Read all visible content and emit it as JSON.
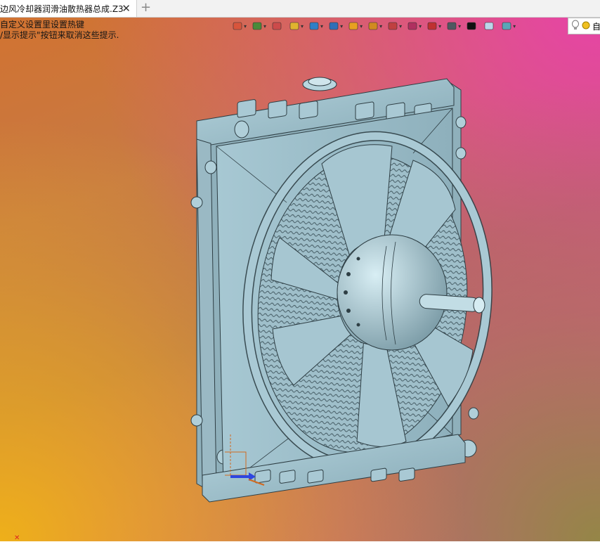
{
  "tab": {
    "title": "边风冷却器润滑油散热器总成.Z3",
    "close": "✕",
    "new": "+"
  },
  "hints": [
    "自定义设置里设置热键",
    "/显示提示\"按钮来取消这些提示."
  ],
  "toolbar": {
    "items": [
      {
        "name": "import-icon",
        "color": "#d8553c"
      },
      {
        "name": "paint-icon",
        "color": "#4a8a3a"
      },
      {
        "name": "brush-icon",
        "color": "#cc4b4b"
      },
      {
        "name": "part-icon",
        "color": "#e0b32f"
      },
      {
        "name": "solid-icon",
        "color": "#2f7fc7"
      },
      {
        "name": "assembly-icon",
        "color": "#2f6fb7"
      },
      {
        "name": "render-icon",
        "color": "#e8a020"
      },
      {
        "name": "zoom-icon",
        "color": "#d18a20"
      },
      {
        "name": "view-icon",
        "color": "#c04040"
      },
      {
        "name": "section-icon",
        "color": "#b03060"
      },
      {
        "name": "measure-icon",
        "color": "#c03030"
      },
      {
        "name": "display-icon",
        "color": "#505860"
      },
      {
        "name": "line-color-icon",
        "color": "#111111"
      },
      {
        "name": "face-color-icon",
        "color": "#bcd6ea"
      },
      {
        "name": "material-icon",
        "color": "#5aa6b8"
      }
    ]
  },
  "light": {
    "label": "自"
  },
  "colors": {
    "model": "#9ebfcb",
    "model_dark": "#5f7f8c",
    "edge": "#2e3e44"
  }
}
